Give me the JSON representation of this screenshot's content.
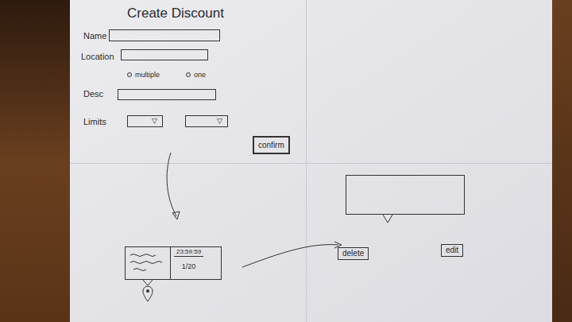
{
  "title": "Create Discount",
  "form": {
    "name_label": "Name",
    "location_label": "Location",
    "location_options": [
      {
        "label": "multiple",
        "selected": false
      },
      {
        "label": "one",
        "selected": false
      }
    ],
    "desc_label": "Desc",
    "limits_label": "Limits",
    "limits_dropdowns": [
      {
        "arrow": "▽"
      },
      {
        "arrow": "▽"
      }
    ],
    "confirm_button": "confirm"
  },
  "card": {
    "timer": "23:59:59",
    "count": "1/20"
  },
  "actions": [
    "delete",
    "edit"
  ]
}
